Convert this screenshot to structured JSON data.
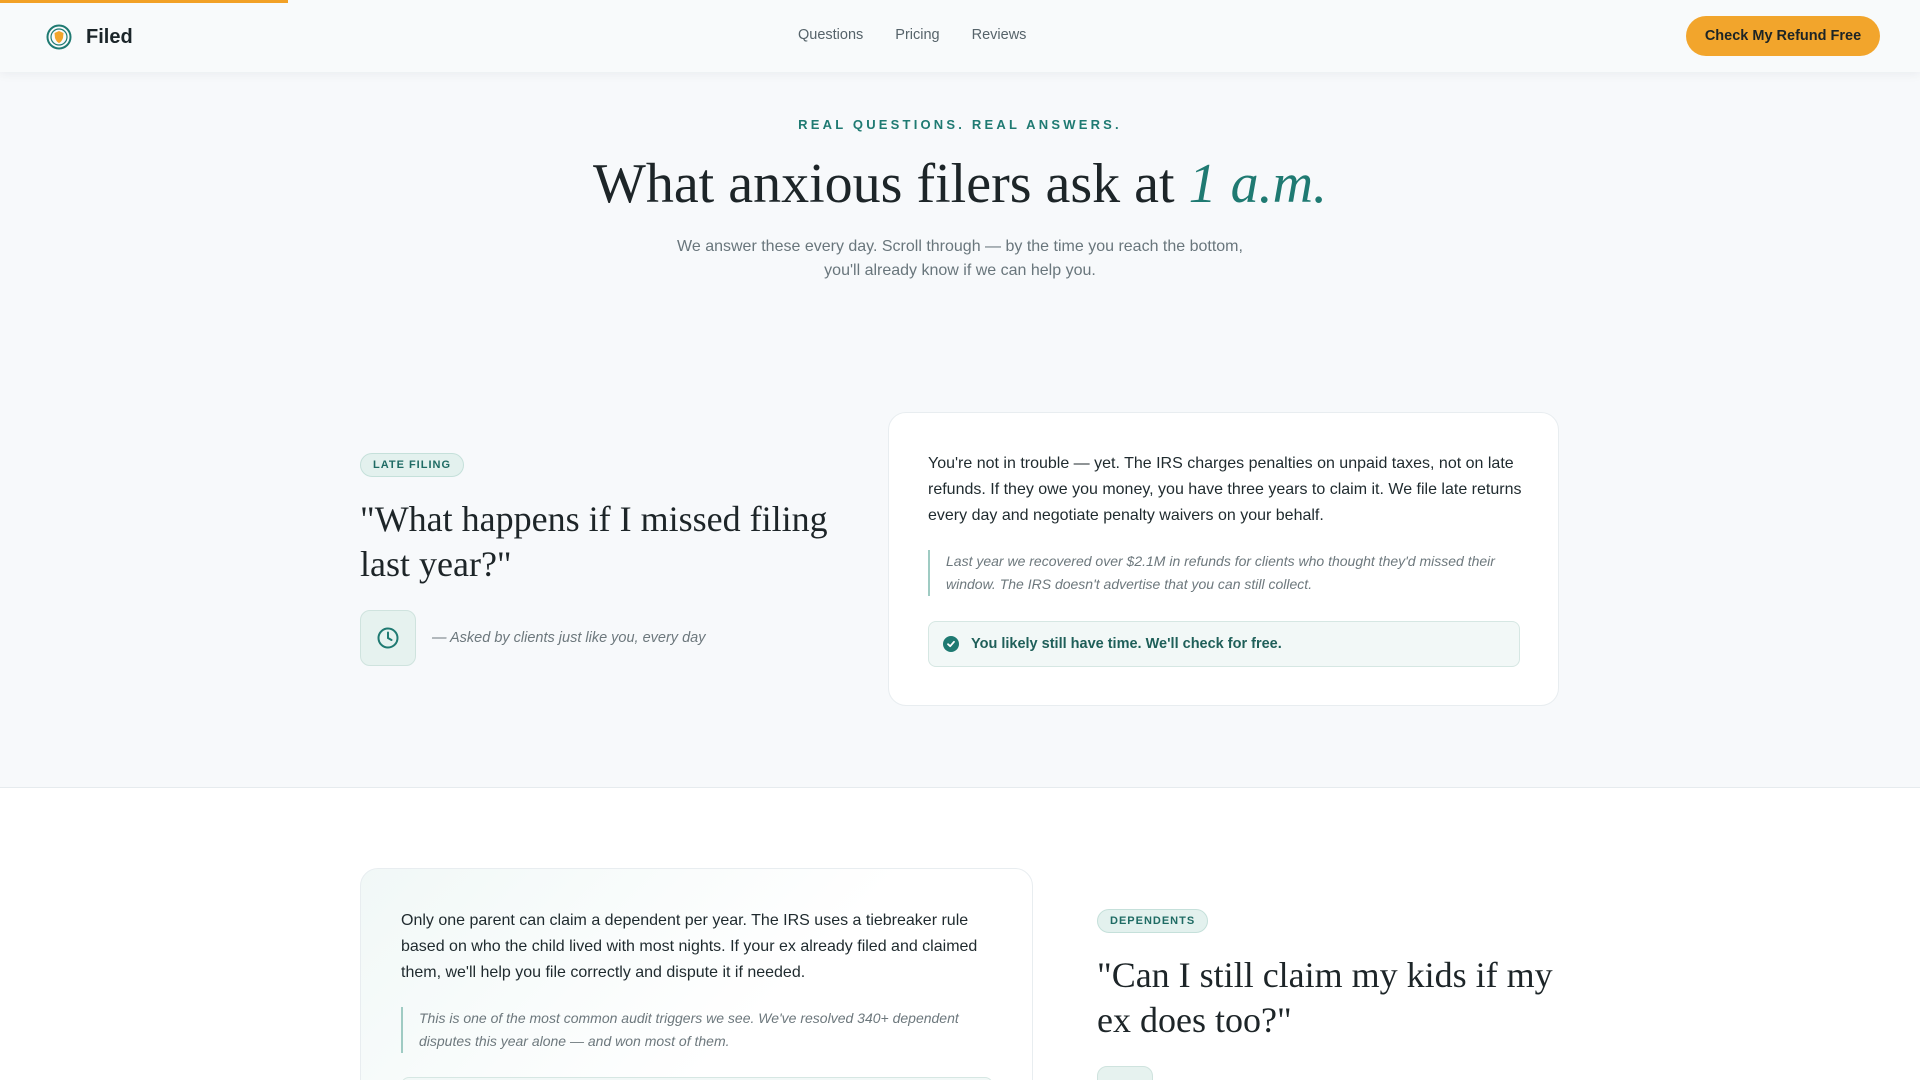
{
  "header": {
    "brand": "Filed",
    "nav": [
      "Questions",
      "Pricing",
      "Reviews"
    ],
    "cta": "Check My Refund Free",
    "scroll_progress": 0.15
  },
  "hero": {
    "eyebrow": "REAL QUESTIONS. REAL ANSWERS.",
    "title_main": "What anxious filers ask at ",
    "title_accent": "1 a.m.",
    "subtitle_line1": "We answer these every day. Scroll through — by the time you reach the bottom,",
    "subtitle_line2": "you'll already know if we can help you."
  },
  "faq": [
    {
      "tag": "LATE FILING",
      "question": "\"What happens if I missed filing last year?\"",
      "asked": "— Asked by clients just like you, every day",
      "answer": "You're not in trouble — yet. The IRS charges penalties on unpaid taxes, not on late refunds. If they owe you money, you have three years to claim it. We file late returns every day and negotiate penalty waivers on your behalf.",
      "quote": "Last year we recovered over $2.1M in refunds for clients who thought they'd missed their window. The IRS doesn't advertise that you can still collect.",
      "reassurance": "You likely still have time. We'll check for free."
    },
    {
      "tag": "DEPENDENTS",
      "question": "\"Can I still claim my kids if my ex does too?\"",
      "answer": "Only one parent can claim a dependent per year. The IRS uses a tiebreaker rule based on who the child lived with most nights. If your ex already filed and claimed them, we'll help you file correctly and dispute it if needed.",
      "quote": "This is one of the most common audit triggers we see. We've resolved 340+ dependent disputes this year alone — and won most of them."
    }
  ],
  "colors": {
    "accent": "#1f7a72",
    "cta": "#f2a52c",
    "progress": "#f2a126",
    "background": "#f7f9fb"
  },
  "icons": {
    "brand": "shield-seal-icon",
    "clock": "clock-icon",
    "check": "check-circle-icon"
  }
}
